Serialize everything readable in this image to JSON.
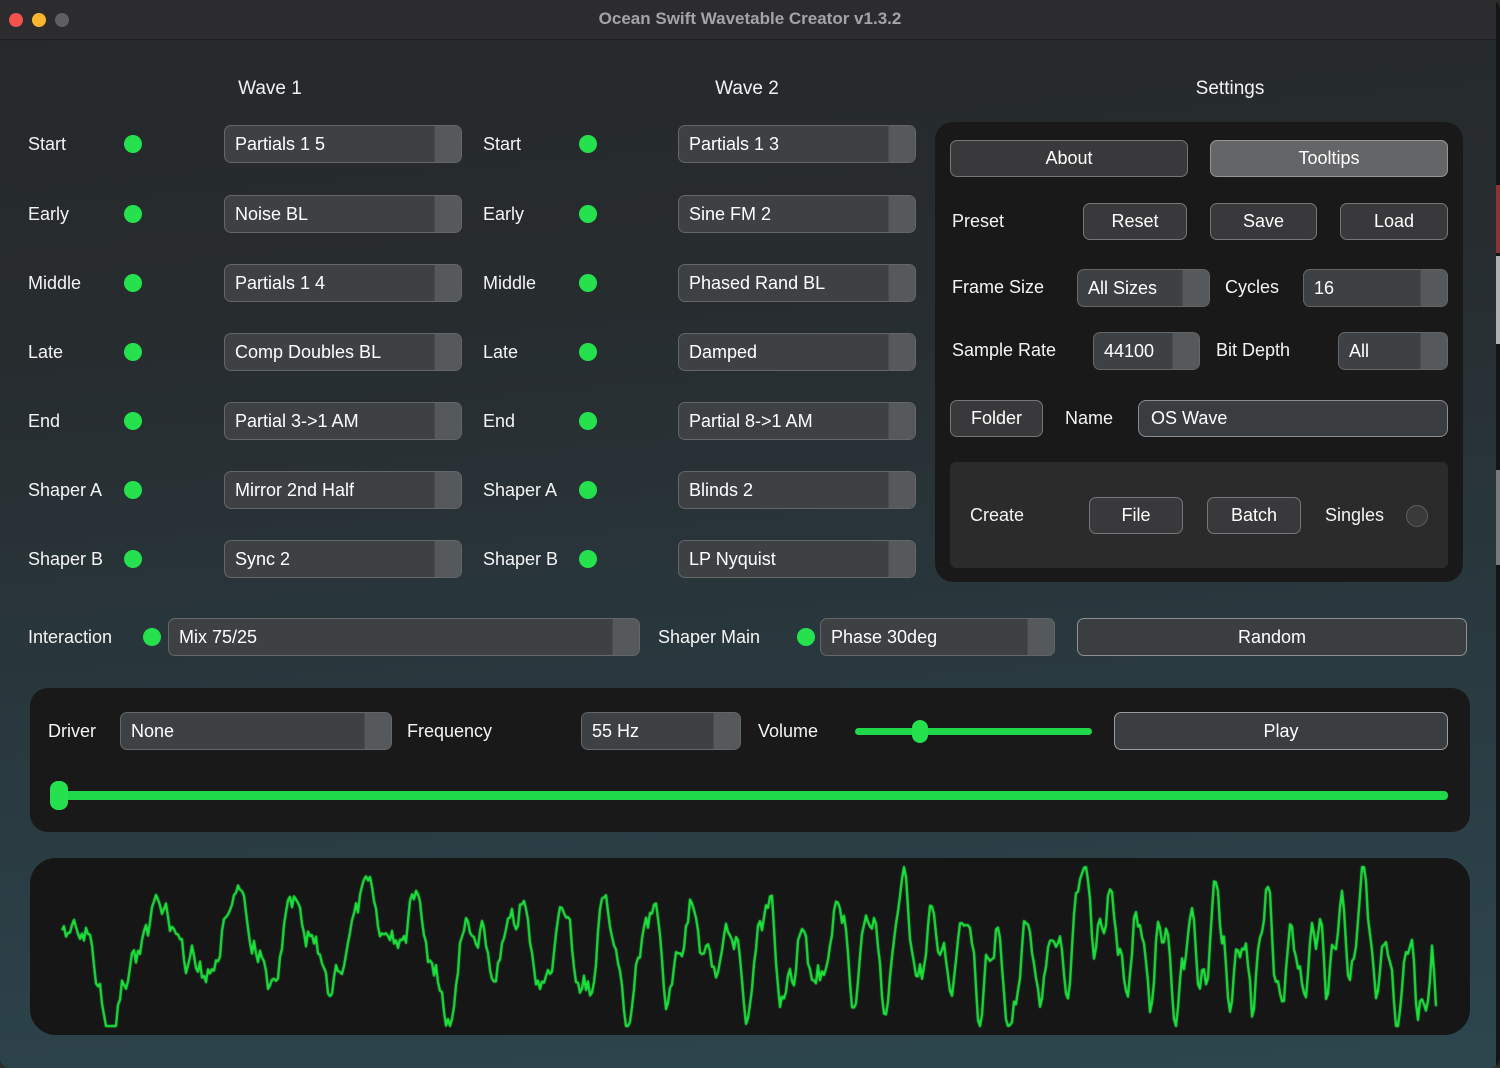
{
  "window": {
    "title": "Ocean Swift Wavetable Creator v1.3.2"
  },
  "headers": {
    "wave1": "Wave 1",
    "wave2": "Wave 2",
    "settings": "Settings"
  },
  "wave1": {
    "rows": [
      {
        "label": "Start",
        "value": "Partials 1 5"
      },
      {
        "label": "Early",
        "value": "Noise BL"
      },
      {
        "label": "Middle",
        "value": "Partials 1 4"
      },
      {
        "label": "Late",
        "value": "Comp Doubles BL"
      },
      {
        "label": "End",
        "value": "Partial 3->1 AM"
      },
      {
        "label": "Shaper A",
        "value": "Mirror 2nd Half"
      },
      {
        "label": "Shaper B",
        "value": "Sync 2"
      }
    ]
  },
  "wave2": {
    "rows": [
      {
        "label": "Start",
        "value": "Partials 1 3"
      },
      {
        "label": "Early",
        "value": "Sine FM 2"
      },
      {
        "label": "Middle",
        "value": "Phased Rand BL"
      },
      {
        "label": "Late",
        "value": "Damped"
      },
      {
        "label": "End",
        "value": "Partial 8->1 AM"
      },
      {
        "label": "Shaper A",
        "value": "Blinds 2"
      },
      {
        "label": "Shaper B",
        "value": "LP Nyquist"
      }
    ]
  },
  "settings": {
    "about_label": "About",
    "tooltips_label": "Tooltips",
    "preset": {
      "label": "Preset",
      "reset": "Reset",
      "save": "Save",
      "load": "Load"
    },
    "frame_size": {
      "label": "Frame Size",
      "value": "All Sizes"
    },
    "cycles": {
      "label": "Cycles",
      "value": "16"
    },
    "sample_rate": {
      "label": "Sample Rate",
      "value": "44100"
    },
    "bit_depth": {
      "label": "Bit Depth",
      "value": "All"
    },
    "folder_label": "Folder",
    "name": {
      "label": "Name",
      "value": "OS Wave"
    },
    "create": {
      "label": "Create",
      "file": "File",
      "batch": "Batch",
      "singles": "Singles"
    }
  },
  "interaction": {
    "label": "Interaction",
    "value": "Mix 75/25"
  },
  "shaper_main": {
    "label": "Shaper Main",
    "value": "Phase 30deg"
  },
  "random_label": "Random",
  "driver_panel": {
    "driver": {
      "label": "Driver",
      "value": "None"
    },
    "frequency": {
      "label": "Frequency",
      "value": "55 Hz"
    },
    "volume": {
      "label": "Volume",
      "percent": 27
    },
    "play_label": "Play",
    "position_percent": 0
  },
  "colors": {
    "accent_green": "#25e14e",
    "slider_green": "#1fd94b",
    "waveform_green": "#1ce23c",
    "background_teal": "#2d464d",
    "panel_dark": "#191919"
  },
  "waveform": {
    "stroke": "#1ce23c",
    "line_width": 2.5,
    "seed": 12,
    "background": "#161617"
  }
}
